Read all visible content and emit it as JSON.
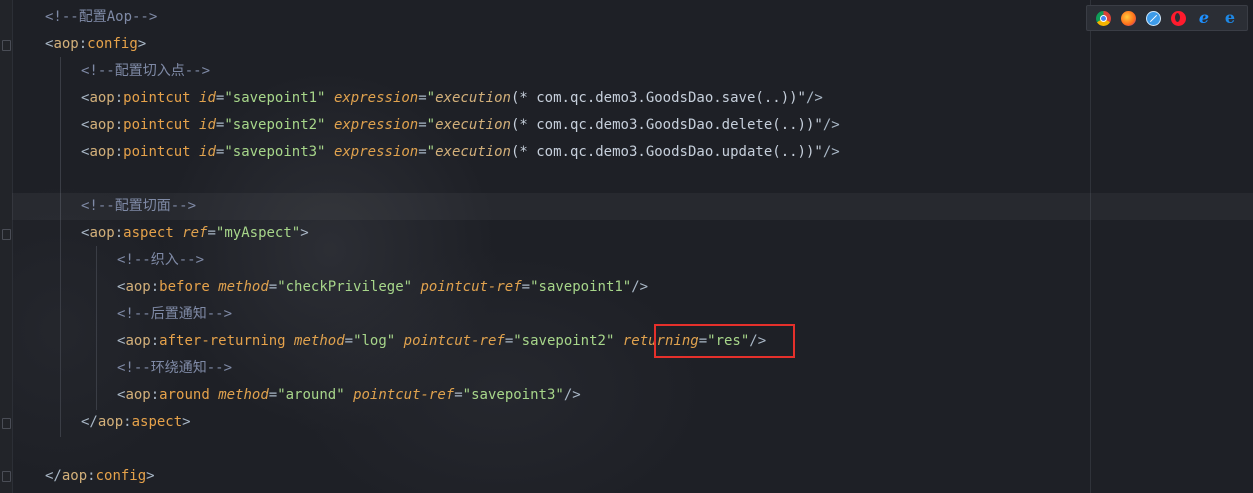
{
  "browser_toolbar": {
    "icons": [
      "chrome-icon",
      "firefox-icon",
      "safari-icon",
      "opera-icon",
      "ie-icon",
      "edge-icon"
    ],
    "ie_glyph": "e",
    "edge_glyph": "e"
  },
  "highlight_color": "#e5302b",
  "code": {
    "line1": {
      "comment": "<!--配置Aop-->"
    },
    "line2": {
      "open": "<",
      "ns": "aop",
      "colon": ":",
      "name": "config",
      "close": ">"
    },
    "line3": {
      "comment": "<!--配置切入点-->"
    },
    "pointcuts": [
      {
        "lt": "<",
        "ns": "aop",
        "colon": ":",
        "name": "pointcut",
        "id_attr": "id",
        "eq": "=",
        "id_val": "\"savepoint1\"",
        "expr_attr": "expression",
        "q": "\"",
        "fn": "execution",
        "args": "(* com.qc.demo3.GoodsDao.save(..))\"",
        "end": "/>"
      },
      {
        "lt": "<",
        "ns": "aop",
        "colon": ":",
        "name": "pointcut",
        "id_attr": "id",
        "eq": "=",
        "id_val": "\"savepoint2\"",
        "expr_attr": "expression",
        "q": "\"",
        "fn": "execution",
        "args": "(* com.qc.demo3.GoodsDao.delete(..))\"",
        "end": "/>"
      },
      {
        "lt": "<",
        "ns": "aop",
        "colon": ":",
        "name": "pointcut",
        "id_attr": "id",
        "eq": "=",
        "id_val": "\"savepoint3\"",
        "expr_attr": "expression",
        "q": "\"",
        "fn": "execution",
        "args": "(* com.qc.demo3.GoodsDao.update(..))\"",
        "end": "/>"
      }
    ],
    "line8": {
      "comment": "<!--配置切面-->"
    },
    "line9": {
      "lt": "<",
      "ns": "aop",
      "colon": ":",
      "name": "aspect",
      "attr": "ref",
      "eq": "=",
      "val": "\"myAspect\"",
      "close": ">"
    },
    "line10": {
      "comment": "<!--织入-->"
    },
    "line11": {
      "lt": "<",
      "ns": "aop",
      "colon": ":",
      "name": "before",
      "a1": "method",
      "eq": "=",
      "v1": "\"checkPrivilege\"",
      "a2": "pointcut-ref",
      "v2": "\"savepoint1\"",
      "end": "/>"
    },
    "line12": {
      "comment": "<!--后置通知-->"
    },
    "line13": {
      "lt": "<",
      "ns": "aop",
      "colon": ":",
      "name": "after-returning",
      "a1": "method",
      "eq": "=",
      "v1": "\"log\"",
      "a2": "pointcut-ref",
      "v2": "\"savepoint2\"",
      "a3": "returning",
      "v3": "\"res\"",
      "end": "/>"
    },
    "line14": {
      "comment": "<!--环绕通知-->"
    },
    "line15": {
      "lt": "<",
      "ns": "aop",
      "colon": ":",
      "name": "around",
      "a1": "method",
      "eq": "=",
      "v1": "\"around\"",
      "a2": "pointcut-ref",
      "v2": "\"savepoint3\"",
      "end": "/>"
    },
    "line16": {
      "open": "</",
      "ns": "aop",
      "colon": ":",
      "name": "aspect",
      "close": ">"
    },
    "line18": {
      "open": "</",
      "ns": "aop",
      "colon": ":",
      "name": "config",
      "close": ">"
    }
  }
}
